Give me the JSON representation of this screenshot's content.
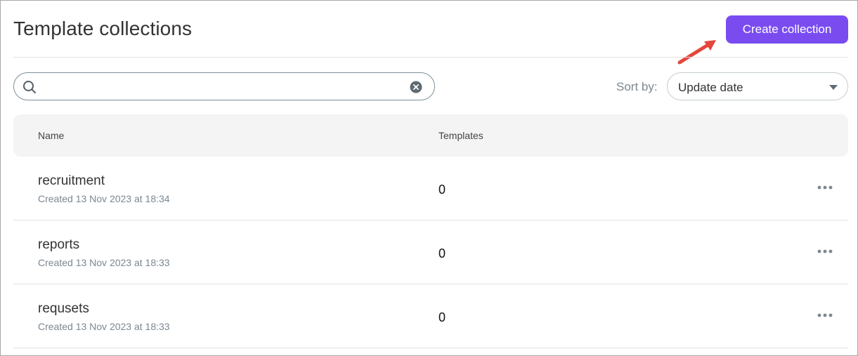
{
  "header": {
    "title": "Template collections",
    "create_button_label": "Create collection"
  },
  "search": {
    "value": "",
    "placeholder": ""
  },
  "sort": {
    "label": "Sort by:",
    "selected": "Update date"
  },
  "table": {
    "columns": {
      "name": "Name",
      "templates": "Templates"
    },
    "rows": [
      {
        "name": "recruitment",
        "created": "Created 13 Nov 2023 at 18:34",
        "templates": "0"
      },
      {
        "name": "reports",
        "created": "Created 13 Nov 2023 at 18:33",
        "templates": "0"
      },
      {
        "name": "requsets",
        "created": "Created 13 Nov 2023 at 18:33",
        "templates": "0"
      }
    ]
  },
  "colors": {
    "accent": "#7a4cf0",
    "annotation_arrow": "#e5463c"
  },
  "icons": {
    "search": "search-icon",
    "clear": "clear-icon",
    "dropdown": "chevron-down-icon",
    "row_menu": "more-horizontal-icon",
    "annotation": "arrow-icon"
  }
}
